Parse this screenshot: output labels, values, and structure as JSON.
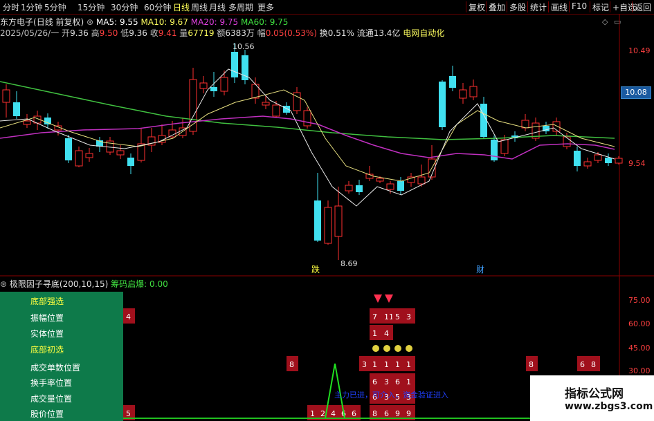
{
  "period_tabs": [
    "分时",
    "1分钟",
    "5分钟",
    "15分钟",
    "30分钟",
    "60分钟",
    "日线",
    "周线",
    "月线",
    "多周期",
    "更多"
  ],
  "active_tab": "日线",
  "toolbar": [
    "复权",
    "叠加",
    "多股",
    "统计",
    "画线",
    "F10",
    "标记",
    "+自选",
    "返回"
  ],
  "stock": {
    "name": "东方电子",
    "mode": "(日线 前复权)"
  },
  "ma": {
    "ma5": "MA5: 9.55",
    "ma10": "MA10: 9.67",
    "ma20": "MA20: 9.75",
    "ma60": "MA60: 9.75"
  },
  "quote": {
    "date": "2025/05/26/一",
    "open_label": "开",
    "open": "9.36",
    "high_label": "高",
    "high": "9.50",
    "low_label": "低",
    "low": "9.36",
    "close_label": "收",
    "close": "9.41",
    "vol_label": "量",
    "vol": "67719",
    "amt_label": "额",
    "amt": "6383万",
    "chg_label": "幅",
    "chg": "0.05(0.53%)",
    "turn": "换0.51%",
    "float": "流通13.4亿",
    "sector": "电网自动化"
  },
  "price_axis": {
    "top": "10.49",
    "current": "10.08",
    "bottom": "9.54"
  },
  "annotations": {
    "high": "10.56",
    "low": "8.69",
    "mark1": "跌",
    "mark2": "财"
  },
  "indicator": {
    "title": "极限因子寻底(200,10,15)",
    "sub": "筹码启爆: 0.00"
  },
  "ind_axis": [
    "75.00",
    "60.00",
    "45.00",
    "30.00"
  ],
  "panel_items": [
    {
      "text": "底部强选",
      "yellow": true
    },
    {
      "text": "振幅位置",
      "yellow": false
    },
    {
      "text": "实体位置",
      "yellow": false
    },
    {
      "text": "底部初选",
      "yellow": true
    },
    {
      "text": "成交单数位置",
      "yellow": false
    },
    {
      "text": "换手率位置",
      "yellow": false
    },
    {
      "text": "成交量位置",
      "yellow": false
    },
    {
      "text": "股价位置",
      "yellow": false
    }
  ],
  "signal_text": "主力已进，可介入，资金验证进入",
  "cells": [
    {
      "col": "a",
      "row": 1,
      "t": "4"
    },
    {
      "col": "a",
      "row": 7,
      "t": "5"
    },
    {
      "col": "b",
      "row": 4,
      "t": "8"
    },
    {
      "col": "c",
      "row": 7,
      "t": "1"
    },
    {
      "col": "d",
      "row": 7,
      "t": "2"
    },
    {
      "col": "e",
      "row": 7,
      "t": "4"
    },
    {
      "col": "f",
      "row": 7,
      "t": "6"
    },
    {
      "col": "g",
      "row": 7,
      "t": "6"
    },
    {
      "col": "h",
      "row": 4,
      "t": "3"
    },
    {
      "col": "i",
      "row": 1,
      "t": "7"
    },
    {
      "col": "j",
      "row": 1,
      "t": "11"
    },
    {
      "col": "k",
      "row": 1,
      "t": "5"
    },
    {
      "col": "l",
      "row": 1,
      "t": "3"
    },
    {
      "col": "i",
      "row": 2,
      "t": "1"
    },
    {
      "col": "j",
      "row": 2,
      "t": "4"
    },
    {
      "col": "i",
      "row": 4,
      "t": "1"
    },
    {
      "col": "j",
      "row": 4,
      "t": "1"
    },
    {
      "col": "k",
      "row": 4,
      "t": "1"
    },
    {
      "col": "l",
      "row": 4,
      "t": "1"
    },
    {
      "col": "i",
      "row": 5,
      "t": "6"
    },
    {
      "col": "j",
      "row": 5,
      "t": "3"
    },
    {
      "col": "k",
      "row": 5,
      "t": "6"
    },
    {
      "col": "l",
      "row": 5,
      "t": "1"
    },
    {
      "col": "i",
      "row": 6,
      "t": "6"
    },
    {
      "col": "j",
      "row": 6,
      "t": "3"
    },
    {
      "col": "k",
      "row": 6,
      "t": "5"
    },
    {
      "col": "l",
      "row": 6,
      "t": "3"
    },
    {
      "col": "i",
      "row": 7,
      "t": "8"
    },
    {
      "col": "j",
      "row": 7,
      "t": "6"
    },
    {
      "col": "k",
      "row": 7,
      "t": "9"
    },
    {
      "col": "l",
      "row": 7,
      "t": "9"
    },
    {
      "col": "m",
      "row": 4,
      "t": "8"
    },
    {
      "col": "n",
      "row": 4,
      "t": "6"
    },
    {
      "col": "o",
      "row": 4,
      "t": "8"
    }
  ],
  "watermark": {
    "line1": "指标公式网",
    "line2": "www.zbgs3.com"
  },
  "colors": {
    "up": "#ff3030",
    "down": "#40e0f0",
    "ma5": "#ffffff",
    "ma10": "#ffff60",
    "ma20": "#e040e0",
    "ma60": "#40e040",
    "cell": "#a0101c"
  }
}
